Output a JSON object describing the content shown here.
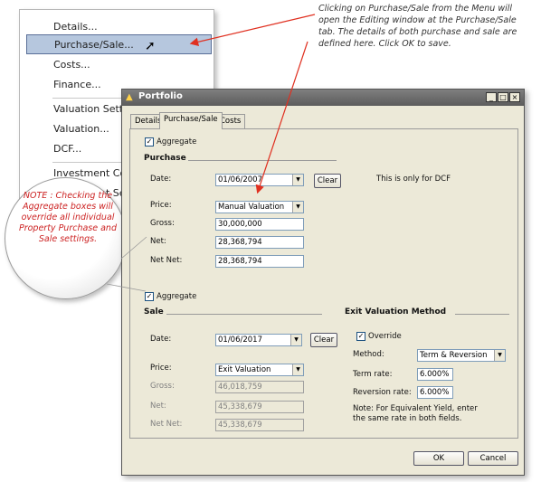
{
  "context_menu": {
    "items": [
      "Details...",
      "Purchase/Sale...",
      "Costs...",
      "Finance...",
      "Valuation Settings",
      "Valuation...",
      "DCF...",
      "Investment Costs",
      "Investment Settings"
    ],
    "selected_index": 1
  },
  "callout": "Clicking on Purchase/Sale from the Menu will open the Editing window at the Purchase/Sale tab. The details of both purchase and sale are defined here. Click OK to save.",
  "bubble_note": "NOTE : Checking the Aggregate boxes will override all individual Property Purchase and Sale settings.",
  "window": {
    "title": "Portfolio",
    "controls": {
      "minimize": "_",
      "maximize": "□",
      "close": "×"
    },
    "tabs": [
      "Details",
      "Purchase/Sale",
      "Costs"
    ],
    "active_tab": "Purchase/Sale"
  },
  "purchase": {
    "aggregate_label": "Aggregate",
    "aggregate_checked": true,
    "header": "Purchase",
    "date_label": "Date:",
    "date_value": "01/06/2007",
    "clear_label": "Clear",
    "dcf_note": "This is only for DCF",
    "price_label": "Price:",
    "price_value": "Manual Valuation",
    "gross_label": "Gross:",
    "gross_value": "30,000,000",
    "net_label": "Net:",
    "net_value": "28,368,794",
    "netnet_label": "Net Net:",
    "netnet_value": "28,368,794"
  },
  "sale": {
    "aggregate_label": "Aggregate",
    "aggregate_checked": true,
    "header": "Sale",
    "date_label": "Date:",
    "date_value": "01/06/2017",
    "clear_label": "Clear",
    "price_label": "Price:",
    "price_value": "Exit Valuation",
    "gross_label": "Gross:",
    "gross_value": "46,018,759",
    "net_label": "Net:",
    "net_value": "45,338,679",
    "netnet_label": "Net Net:",
    "netnet_value": "45,338,679"
  },
  "exit_valuation": {
    "header": "Exit Valuation Method",
    "override_label": "Override",
    "override_checked": true,
    "method_label": "Method:",
    "method_value": "Term & Reversion",
    "term_label": "Term rate:",
    "term_value": "6.000%",
    "reversion_label": "Reversion rate:",
    "reversion_value": "6.000%",
    "note": "Note: For Equivalent Yield, enter the same rate in both fields."
  },
  "footer": {
    "ok_label": "OK",
    "cancel_label": "Cancel"
  },
  "colors": {
    "menu_selected": "#b6c7de",
    "callout_arrow": "#e03020",
    "bubble_text": "#cc2222"
  }
}
